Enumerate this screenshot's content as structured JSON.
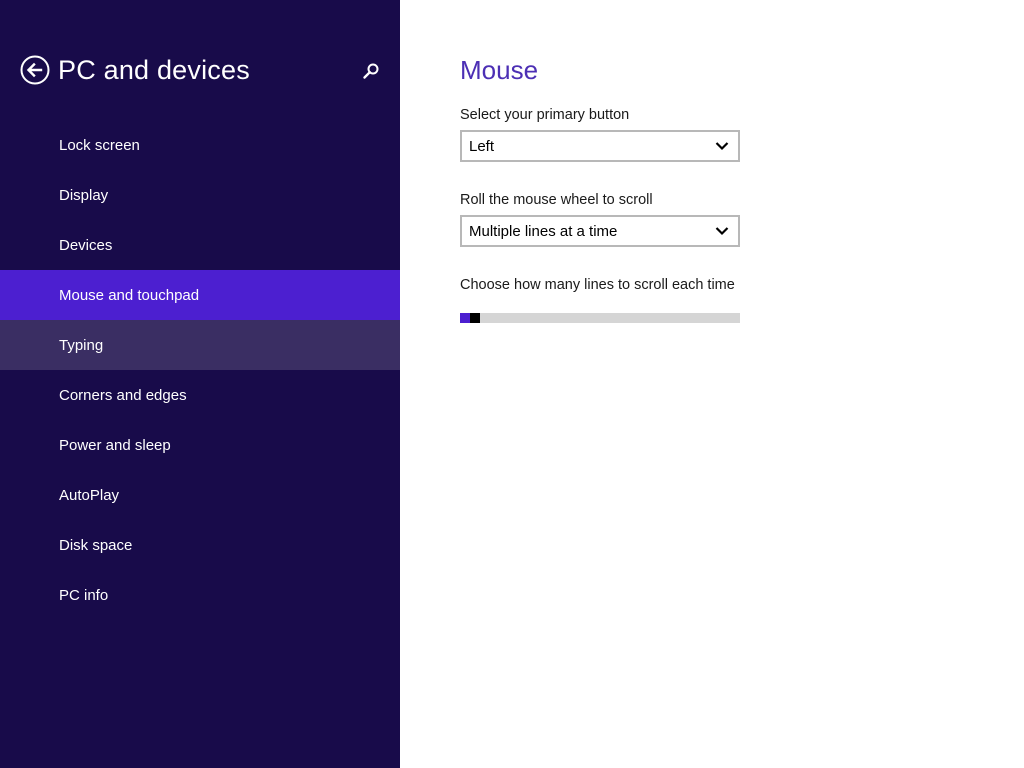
{
  "sidebar": {
    "title": "PC and devices",
    "back_icon": "back-arrow-icon",
    "search_icon": "search-icon",
    "items": [
      {
        "label": "Lock screen",
        "state": "normal"
      },
      {
        "label": "Display",
        "state": "normal"
      },
      {
        "label": "Devices",
        "state": "normal"
      },
      {
        "label": "Mouse and touchpad",
        "state": "selected"
      },
      {
        "label": "Typing",
        "state": "hover"
      },
      {
        "label": "Corners and edges",
        "state": "normal"
      },
      {
        "label": "Power and sleep",
        "state": "normal"
      },
      {
        "label": "AutoPlay",
        "state": "normal"
      },
      {
        "label": "Disk space",
        "state": "normal"
      },
      {
        "label": "PC info",
        "state": "normal"
      }
    ]
  },
  "main": {
    "title": "Mouse",
    "primary_button": {
      "label": "Select your primary button",
      "value": "Left"
    },
    "wheel_scroll": {
      "label": "Roll the mouse wheel to scroll",
      "value": "Multiple lines at a time"
    },
    "lines_to_scroll": {
      "label": "Choose how many lines to scroll each time",
      "value_fraction": 0.03
    }
  },
  "colors": {
    "sidebar_bg": "#180b4a",
    "selected_item": "#4c1fd0",
    "hover_item": "#3a2e63",
    "accent_title": "#4c2fb4",
    "slider_track": "#d5d5d5",
    "slider_thumb": "#000000"
  }
}
